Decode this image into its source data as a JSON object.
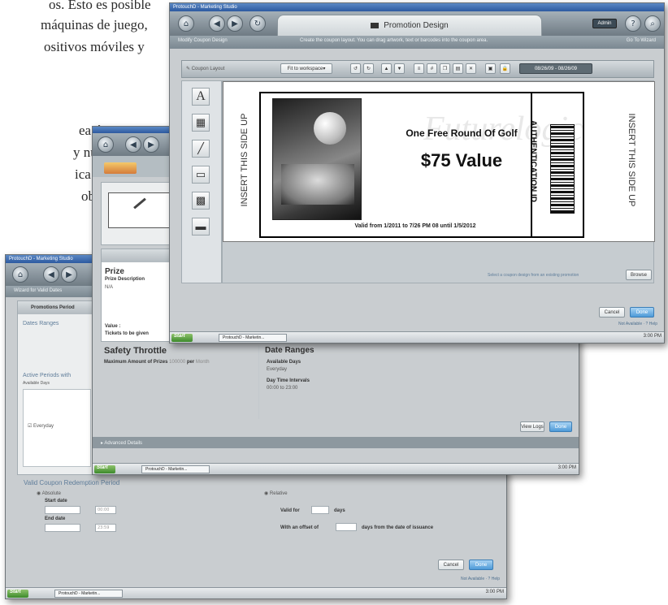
{
  "background_text": {
    "line1": "os. Esto es posible",
    "line2": "máquinas de juego,",
    "line3": "ositivos móviles y",
    "line4": "ea única",
    "line5": "y nuevos",
    "line6": "ica John",
    "line7": "obal de"
  },
  "back_window": {
    "title": "ProtouchD - Marketing Studio",
    "subtitle": "Wizard for Valid Dates",
    "section": "Promotions Period",
    "dates_ranges": "Dates Ranges",
    "active_periods": "Active Periods with",
    "available_days": "Available Days",
    "everyday": "Everyday",
    "valid_coupon": "Valid Coupon Redemption Period",
    "absolute": "Absolute",
    "relative": "Relative",
    "start_date": "Start date",
    "end_date": "End date",
    "start_time": "00:00",
    "end_time": "23:59",
    "valid_for": "Valid for",
    "days": "days",
    "with_offset": "With an offset of",
    "days_from": "days from the date of issuance",
    "cancel": "Cancel",
    "done": "Done",
    "status": "Not Available · ? Help",
    "start": "Start",
    "taskbar_item": "ProtouchD - Marketin...",
    "clock": "3:00 PM"
  },
  "mid_window": {
    "prize": "Prize",
    "prize_description": "Prize Description",
    "prize_desc_value": "N/A",
    "value_label": "Value :",
    "tickets_label": "Tickets to be given",
    "safety": "Safety Throttle",
    "max_amount": "Maximum Amount of Prizes",
    "max_value": "100000",
    "per": "per",
    "period": "Month",
    "date_ranges": "Date Ranges",
    "available_days": "Available Days",
    "everyday": "Everyday",
    "day_time": "Day Time Intervals",
    "time_range": "00:00 to 23:00",
    "advanced": "Advanced Details",
    "view_logs": "View Logs",
    "done": "Done",
    "start": "Start",
    "taskbar_item": "ProtouchD - Marketin...",
    "clock": "3:00 PM"
  },
  "front_window": {
    "title": "ProtouchD - Marketing Studio",
    "tab_title": "Promotion Design",
    "subbar_left": "Modify Coupon Design",
    "subbar_mid": "Create the coupon layout. You can drag artwork, text or barcodes into the coupon area.",
    "subbar_right": "Go To Wizard",
    "layout_label": "Coupon Layout",
    "fit_option": "Fit to workspace",
    "date_range": "08/26/09 - 08/26/09",
    "insert_left": "INSERT THIS SIDE UP",
    "insert_right": "INSERT THIS SIDE UP",
    "coupon_title": "One Free Round Of Golf",
    "coupon_value": "$75 Value",
    "valid_text": "Valid from 1/2011 to 7/26 PM 08 until 1/5/2012",
    "auth": "AUTHENTICATION ID",
    "select_hint": "Select a coupon design from an existing promotion",
    "browse": "Browse",
    "cancel": "Cancel",
    "done": "Done",
    "status": "Not Available · ? Help",
    "start": "Start",
    "taskbar_item": "ProtouchD - Marketin...",
    "clock": "3:00 PM",
    "user_label": "Admin"
  }
}
